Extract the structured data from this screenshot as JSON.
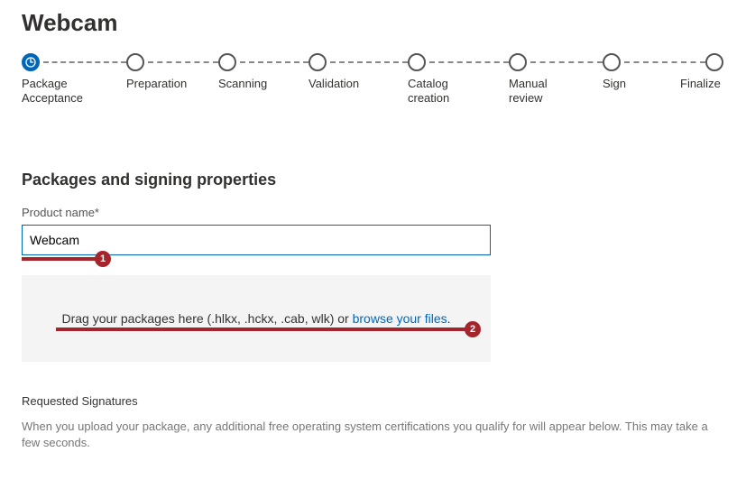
{
  "header": {
    "title": "Webcam"
  },
  "stepper": {
    "steps": [
      {
        "label": "Package\nAcceptance",
        "active": true
      },
      {
        "label": "Preparation",
        "active": false
      },
      {
        "label": "Scanning",
        "active": false
      },
      {
        "label": "Validation",
        "active": false
      },
      {
        "label": "Catalog\ncreation",
        "active": false
      },
      {
        "label": "Manual\nreview",
        "active": false
      },
      {
        "label": "Sign",
        "active": false
      },
      {
        "label": "Finalize",
        "active": false
      }
    ]
  },
  "section": {
    "title": "Packages and signing properties",
    "product_name_label": "Product name*",
    "product_name_value": "Webcam",
    "callout1": "1",
    "callout2": "2",
    "dropzone_prefix": "Drag your packages here (.hlkx, .hckx, .cab, wlk) or ",
    "dropzone_link": "browse your files",
    "dropzone_suffix": ".",
    "signatures_title": "Requested Signatures",
    "signatures_desc": "When you upload your package, any additional free operating system certifications you qualify for will appear below. This may take a few seconds."
  }
}
